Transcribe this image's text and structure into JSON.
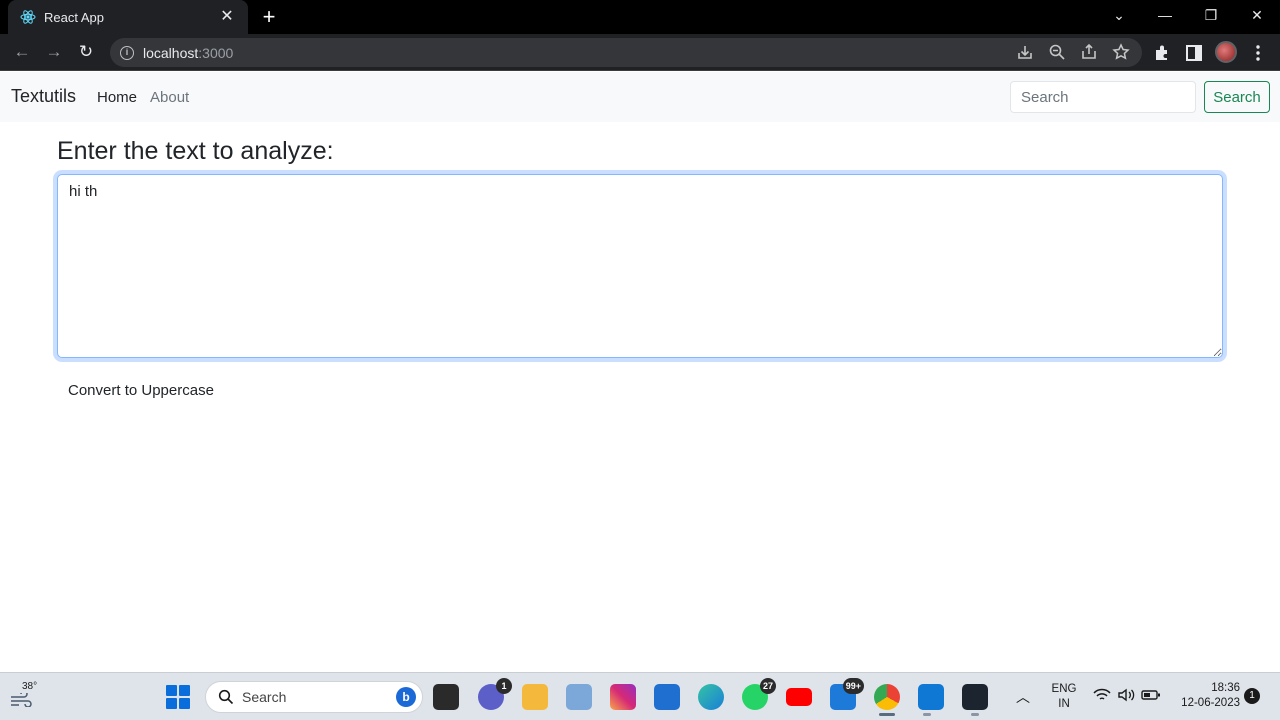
{
  "browser": {
    "tab_title": "React App",
    "close_glyph": "✕",
    "new_tab_glyph": "+",
    "window_controls": {
      "minimize": "—",
      "restore": "❐",
      "close": "✕",
      "tabsearch": "⌄"
    },
    "url_host": "localhost",
    "url_port": ":3000",
    "back_glyph": "←",
    "forward_glyph": "→",
    "reload_glyph": "↻",
    "info_glyph": "i"
  },
  "navbar": {
    "brand": "Textutils",
    "links": [
      {
        "label": "Home"
      },
      {
        "label": "About"
      }
    ],
    "search_placeholder": "Search",
    "search_button": "Search"
  },
  "main": {
    "heading": "Enter the text to analyze:",
    "text_value": "hi th",
    "convert_button": "Convert to Uppercase"
  },
  "taskbar": {
    "weather_temp": "38°",
    "search_label": "Search",
    "chat_badge": "1",
    "whatsapp_badge": "27",
    "mail_badge": "99+",
    "lang_line1": "ENG",
    "lang_line2": "IN",
    "time": "18:36",
    "date": "12-06-2023",
    "notification_count": "1"
  },
  "colors": {
    "accent_green": "#198754",
    "focus_blue": "#86b7fe",
    "navbar_bg": "#f8f9fa",
    "chrome_dark": "#202124"
  },
  "icons": [
    "react-favicon",
    "info-icon",
    "install-icon",
    "zoom-icon",
    "share-icon",
    "bookmark-star-icon",
    "extensions-icon",
    "side-panel-icon",
    "profile-avatar",
    "menu-icon",
    "windows-start-icon",
    "search-icon",
    "bing-icon",
    "teams-chat-icon",
    "file-explorer-icon",
    "photos-icon",
    "instagram-icon",
    "store-icon",
    "edge-icon",
    "whatsapp-icon",
    "youtube-icon",
    "mail-icon",
    "chrome-icon",
    "vscode-icon",
    "terminal-icon",
    "wifi-icon",
    "volume-icon",
    "battery-icon"
  ]
}
